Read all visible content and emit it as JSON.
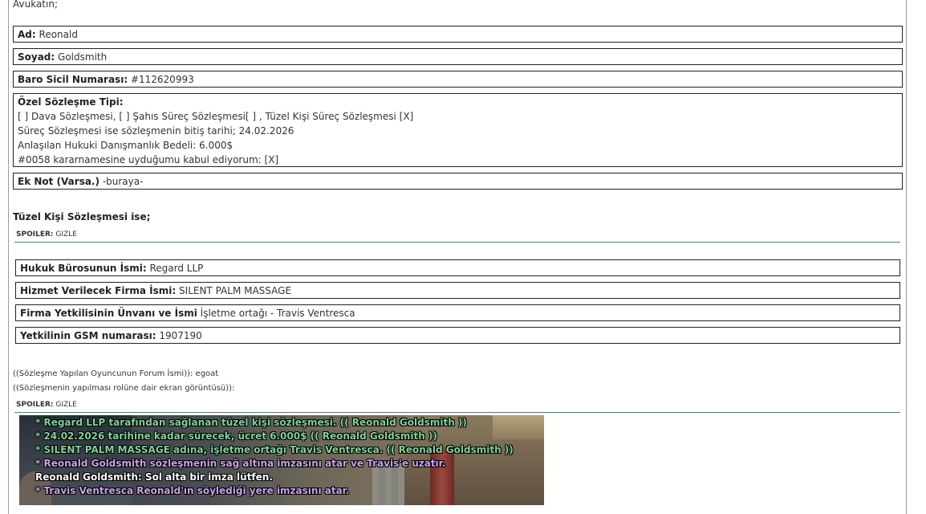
{
  "intro": "Avukatın;",
  "fields": {
    "ad": {
      "label": "Ad:",
      "value": "Reonald"
    },
    "soyad": {
      "label": "Soyad:",
      "value": "Goldsmith"
    },
    "baro": {
      "label": "Baro Sicil Numarası:",
      "value": "#112620993"
    },
    "ozel": {
      "label": "Özel Sözleşme Tipi:",
      "lines": [
        "[ ] Dava Sözleşmesi, [ ] Şahıs Süreç Sözleşmesi[ ] , Tüzel Kişi Süreç Sözleşmesi [X]",
        "Süreç Sözleşmesi ise sözleşmenin bitiş tarihi; 24.02.2026",
        "Anlaşılan Hukuki Danışmanlık Bedeli: 6.000$",
        "#0058 kararnamesine uyduğumu kabul ediyorum: [X]"
      ]
    },
    "eknot": {
      "label": "Ek Not (Varsa.)",
      "value": "-buraya-"
    }
  },
  "tuzel_heading": "Tüzel Kişi Sözleşmesi ise;",
  "spoiler1": {
    "label": "SPOILER:",
    "toggle": "GIZLE"
  },
  "company": {
    "buro": {
      "label": "Hukuk Bürosunun İsmi:",
      "value": "Regard LLP"
    },
    "firma": {
      "label": "Hizmet Verilecek Firma İsmi:",
      "value": "SILENT PALM MASSAGE"
    },
    "yetkili": {
      "label": "Firma Yetkilisinin Ünvanı ve İsmi",
      "value": "İşletme ortağı - Travis Ventresca"
    },
    "gsm": {
      "label": "Yetkilinin GSM numarası:",
      "value": "1907190"
    }
  },
  "forum_name": "((Sözleşme Yapılan Oyuncunun Forum İsmi)): egoat",
  "screenshot_caption": "((Sözleşmenin yapılması rolüne dair ekran görüntüsü)):",
  "spoiler2": {
    "label": "SPOILER:",
    "toggle": "GIZLE"
  },
  "chat_lines": [
    {
      "text": "* Regard LLP tarafından sağlanan tüzel kişi sözleşmesi. (( Reonald Goldsmith ))",
      "color": "#7fd39a"
    },
    {
      "text": "* 24.02.2026 tarihine kadar sürecek, ücret 6.000$ (( Reonald Goldsmith ))",
      "color": "#7fd39a"
    },
    {
      "text": "* SILENT PALM MASSAGE adına, işletme ortağı Travis Ventresca. (( Reonald Goldsmith ))",
      "color": "#7fd39a"
    },
    {
      "text": "* Reonald Goldsmith sözleşmenin sağ altına imzasını atar ve Travis'e uzatır.",
      "color": "#c8a2e8"
    },
    {
      "text": "Reonald Goldsmith: Sol alta bir imza lütfen.",
      "color": "#ffffff"
    },
    {
      "text": "* Travis Ventresca Reonald'ın söylediği yere imzasını atar.",
      "color": "#c8a2e8"
    }
  ]
}
